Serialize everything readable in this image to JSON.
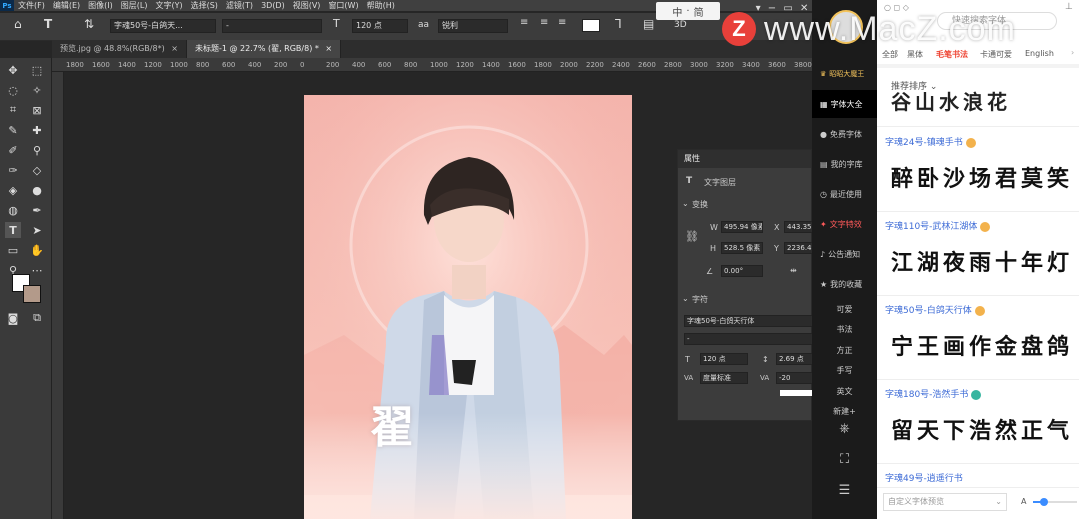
{
  "menubar": {
    "items": [
      "文件(F)",
      "编辑(E)",
      "图像(I)",
      "图层(L)",
      "文字(Y)",
      "选择(S)",
      "滤镜(T)",
      "3D(D)",
      "视图(V)",
      "窗口(W)",
      "帮助(H)"
    ]
  },
  "options": {
    "font_family": "字魂50号-白鸽天...",
    "font_style": "-",
    "font_size": "120 点",
    "antialias_icon": "aa",
    "antialias": "锐利",
    "color_swatch": "#ffffff",
    "three_d": "3D"
  },
  "ime": {
    "lang": "中",
    "mode": "简"
  },
  "tabs": [
    {
      "label": "预览.jpg @ 48.8%(RGB/8*)",
      "close": "×"
    },
    {
      "label": "未标题-1 @ 22.7% (翟, RGB/8) *",
      "close": "×"
    }
  ],
  "ruler": {
    "marks": [
      "1800",
      "1600",
      "1400",
      "1200",
      "1000",
      "800",
      "600",
      "400",
      "200",
      "0",
      "200",
      "400",
      "600",
      "800",
      "1000",
      "1200",
      "1400",
      "1600",
      "1800",
      "2000",
      "2200",
      "2400",
      "2600",
      "2800",
      "3000",
      "3200",
      "3400",
      "3600",
      "3800"
    ]
  },
  "canvas": {
    "glyph": "翟",
    "bg_color": "#f5b7ad"
  },
  "properties": {
    "tab": "属性",
    "layer_type": "文字图层",
    "transform_title": "变换",
    "w_label": "W",
    "w_value": "495.94 像素",
    "x_label": "X",
    "x_value": "443.35",
    "h_label": "H",
    "h_value": "528.5 像素",
    "y_label": "Y",
    "y_value": "2236.49",
    "angle": "0.00°",
    "char_title": "字符",
    "font_family": "字魂50号-白鸽天行体",
    "font_style": "-",
    "size": "120 点",
    "leading": "2.69 点",
    "kerning": "度量标准",
    "tracking": "-20"
  },
  "fontnav": {
    "vip": "昭昭大魔王",
    "items": [
      {
        "icon": "▦",
        "label": "字体大全",
        "state": "active"
      },
      {
        "icon": "●",
        "label": "免费字体",
        "state": ""
      },
      {
        "icon": "▤",
        "label": "我的字库",
        "state": ""
      },
      {
        "icon": "◷",
        "label": "最近使用",
        "state": ""
      },
      {
        "icon": "✦",
        "label": "文字特效",
        "state": "hot"
      },
      {
        "icon": "♪",
        "label": "公告通知",
        "state": ""
      },
      {
        "icon": "★",
        "label": "我的收藏",
        "state": ""
      }
    ],
    "subs": [
      "可爱",
      "书法",
      "方正",
      "手写",
      "英文",
      "新建+"
    ],
    "bottom_icons": [
      "gift-icon",
      "skin-icon",
      "menu-icon"
    ]
  },
  "fontlist": {
    "search_placeholder": "快速搜索字体",
    "categories": [
      "全部",
      "黑体",
      "毛笔书法",
      "卡通可爱",
      "English"
    ],
    "selected_category": "毛笔书法",
    "sort": "推荐排序",
    "fonts": [
      {
        "name": "字魂24号-镇魂手书",
        "sample": "醉卧沙场君莫笑"
      },
      {
        "name": "字魂110号-武林江湖体",
        "sample": "江湖夜雨十年灯"
      },
      {
        "name": "字魂50号-白鸽天行体",
        "sample": "宁王画作金盘鸽"
      },
      {
        "name": "字魂180号-浩然手书",
        "sample": "留天下浩然正气"
      },
      {
        "name": "字魂49号-逍遥行书",
        "sample": ""
      }
    ],
    "top_sample": "谷山水浪花",
    "preview_placeholder": "自定义字体预览",
    "size_label": "A"
  },
  "watermark": {
    "logo": "Z",
    "text": "www.MacZ.com"
  }
}
